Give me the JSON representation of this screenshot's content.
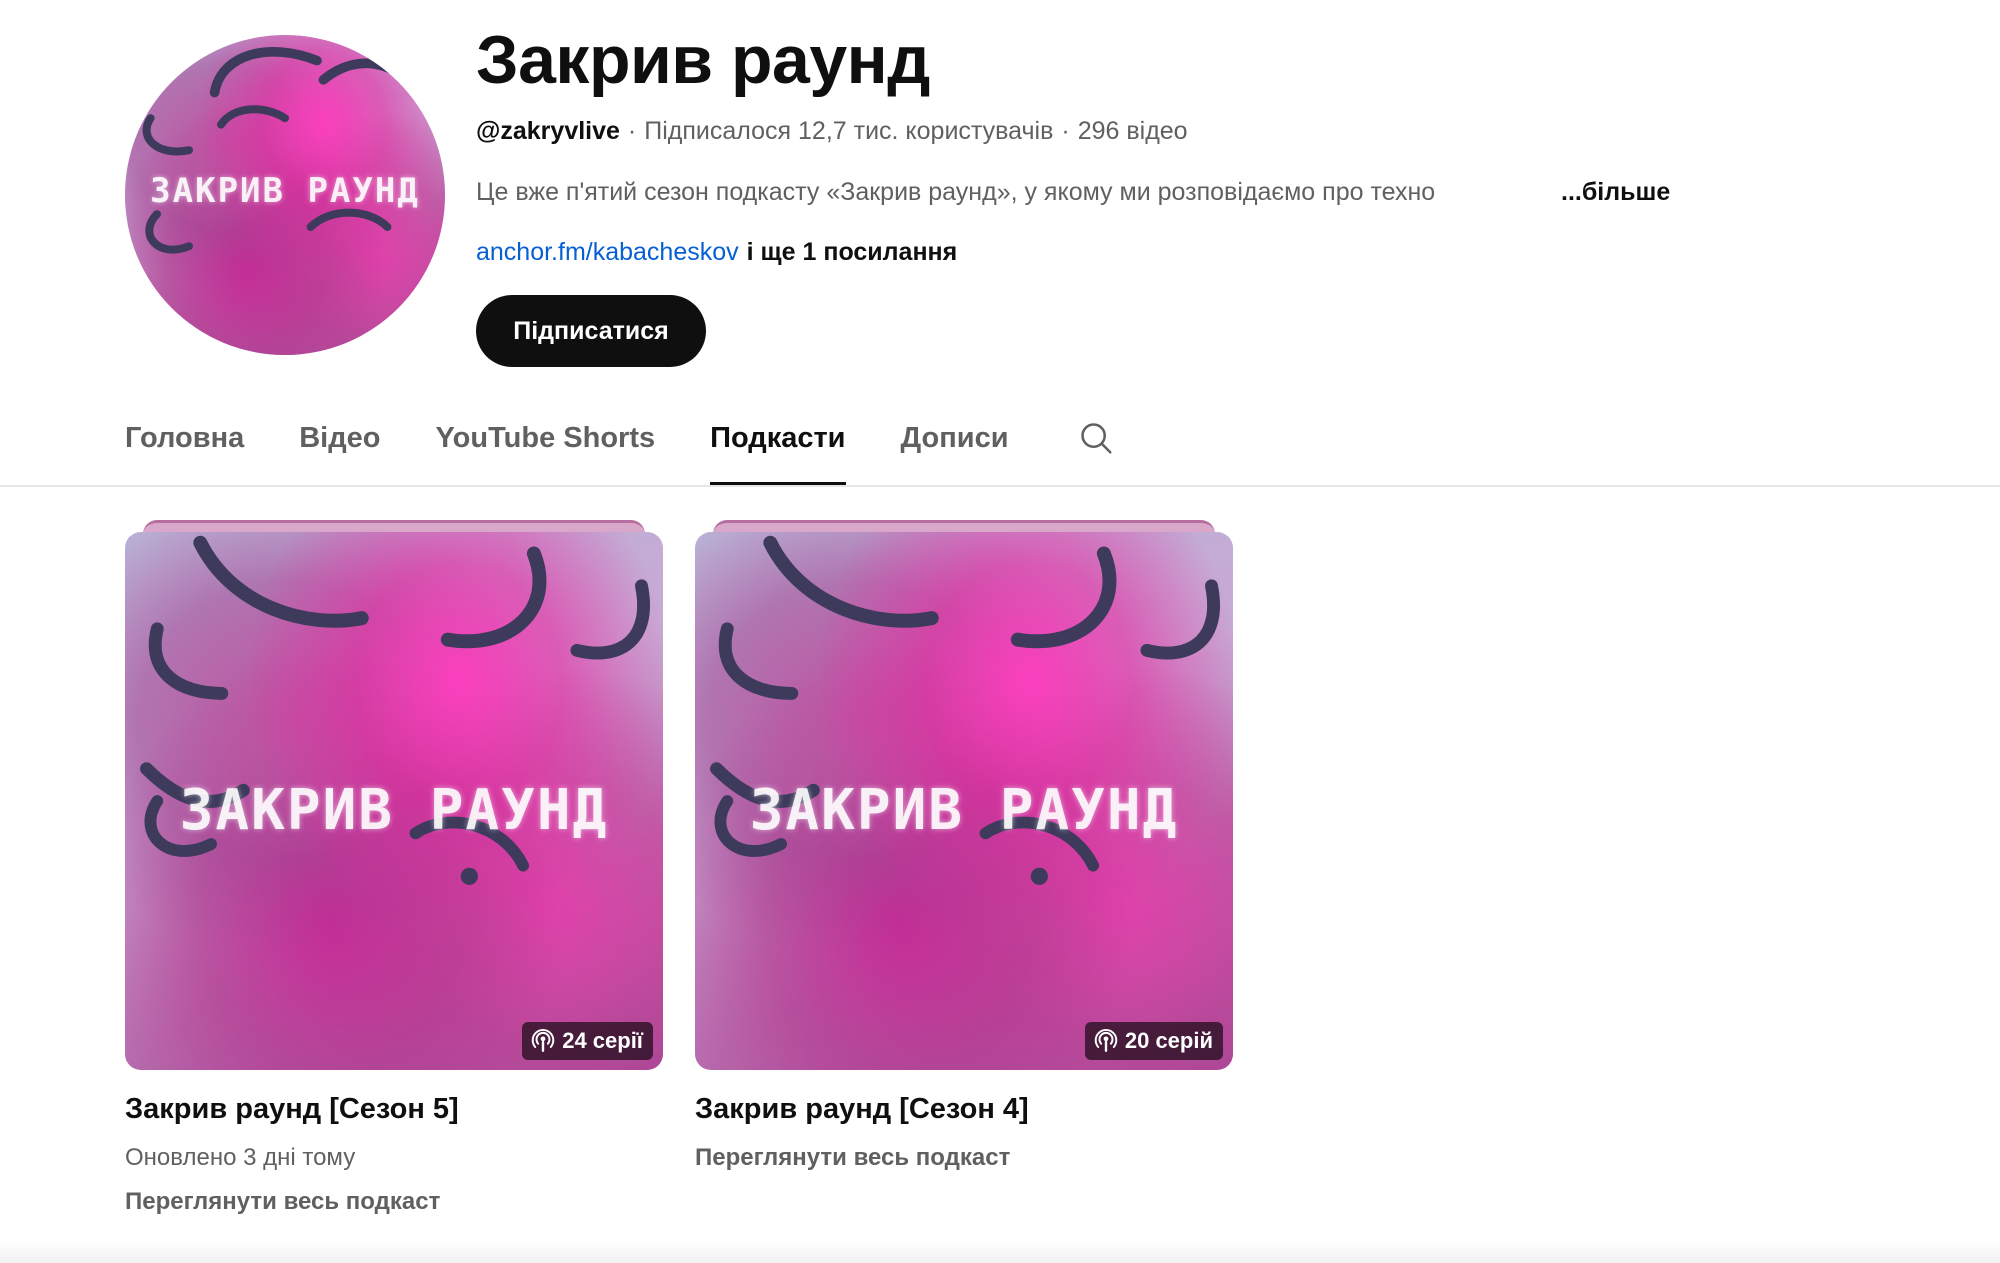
{
  "channel": {
    "name": "Закрив раунд",
    "handle": "@zakryvlive",
    "subscribers": "Підписалося 12,7 тис. користувачів",
    "video_count": "296 відео",
    "separator": "·",
    "description": "Це вже п'ятий сезон подкасту «Закрив раунд», у якому ми розповідаємо про техно",
    "more_label": "...більше",
    "link": "anchor.fm/kabacheskov",
    "more_links": "і ще 1 посилання",
    "subscribe_label": "Підписатися",
    "avatar_text": "ЗАКРИВ РАУНД",
    "accent_color": "#e0309a"
  },
  "tabs": [
    {
      "label": "Головна",
      "active": false
    },
    {
      "label": "Відео",
      "active": false
    },
    {
      "label": "YouTube Shorts",
      "active": false
    },
    {
      "label": "Подкасти",
      "active": true
    },
    {
      "label": "Дописи",
      "active": false
    }
  ],
  "search_icon": "search-icon",
  "podcasts": [
    {
      "title": "Закрив раунд [Сезон 5]",
      "cover_text": "ЗАКРИВ РАУНД",
      "episodes": "24 серії",
      "updated": "Оновлено 3 дні тому",
      "view_all": "Переглянути весь подкаст"
    },
    {
      "title": "Закрив раунд [Сезон 4]",
      "cover_text": "ЗАКРИВ РАУНД",
      "episodes": "20 серій",
      "view_all": "Переглянути весь подкаст"
    }
  ]
}
